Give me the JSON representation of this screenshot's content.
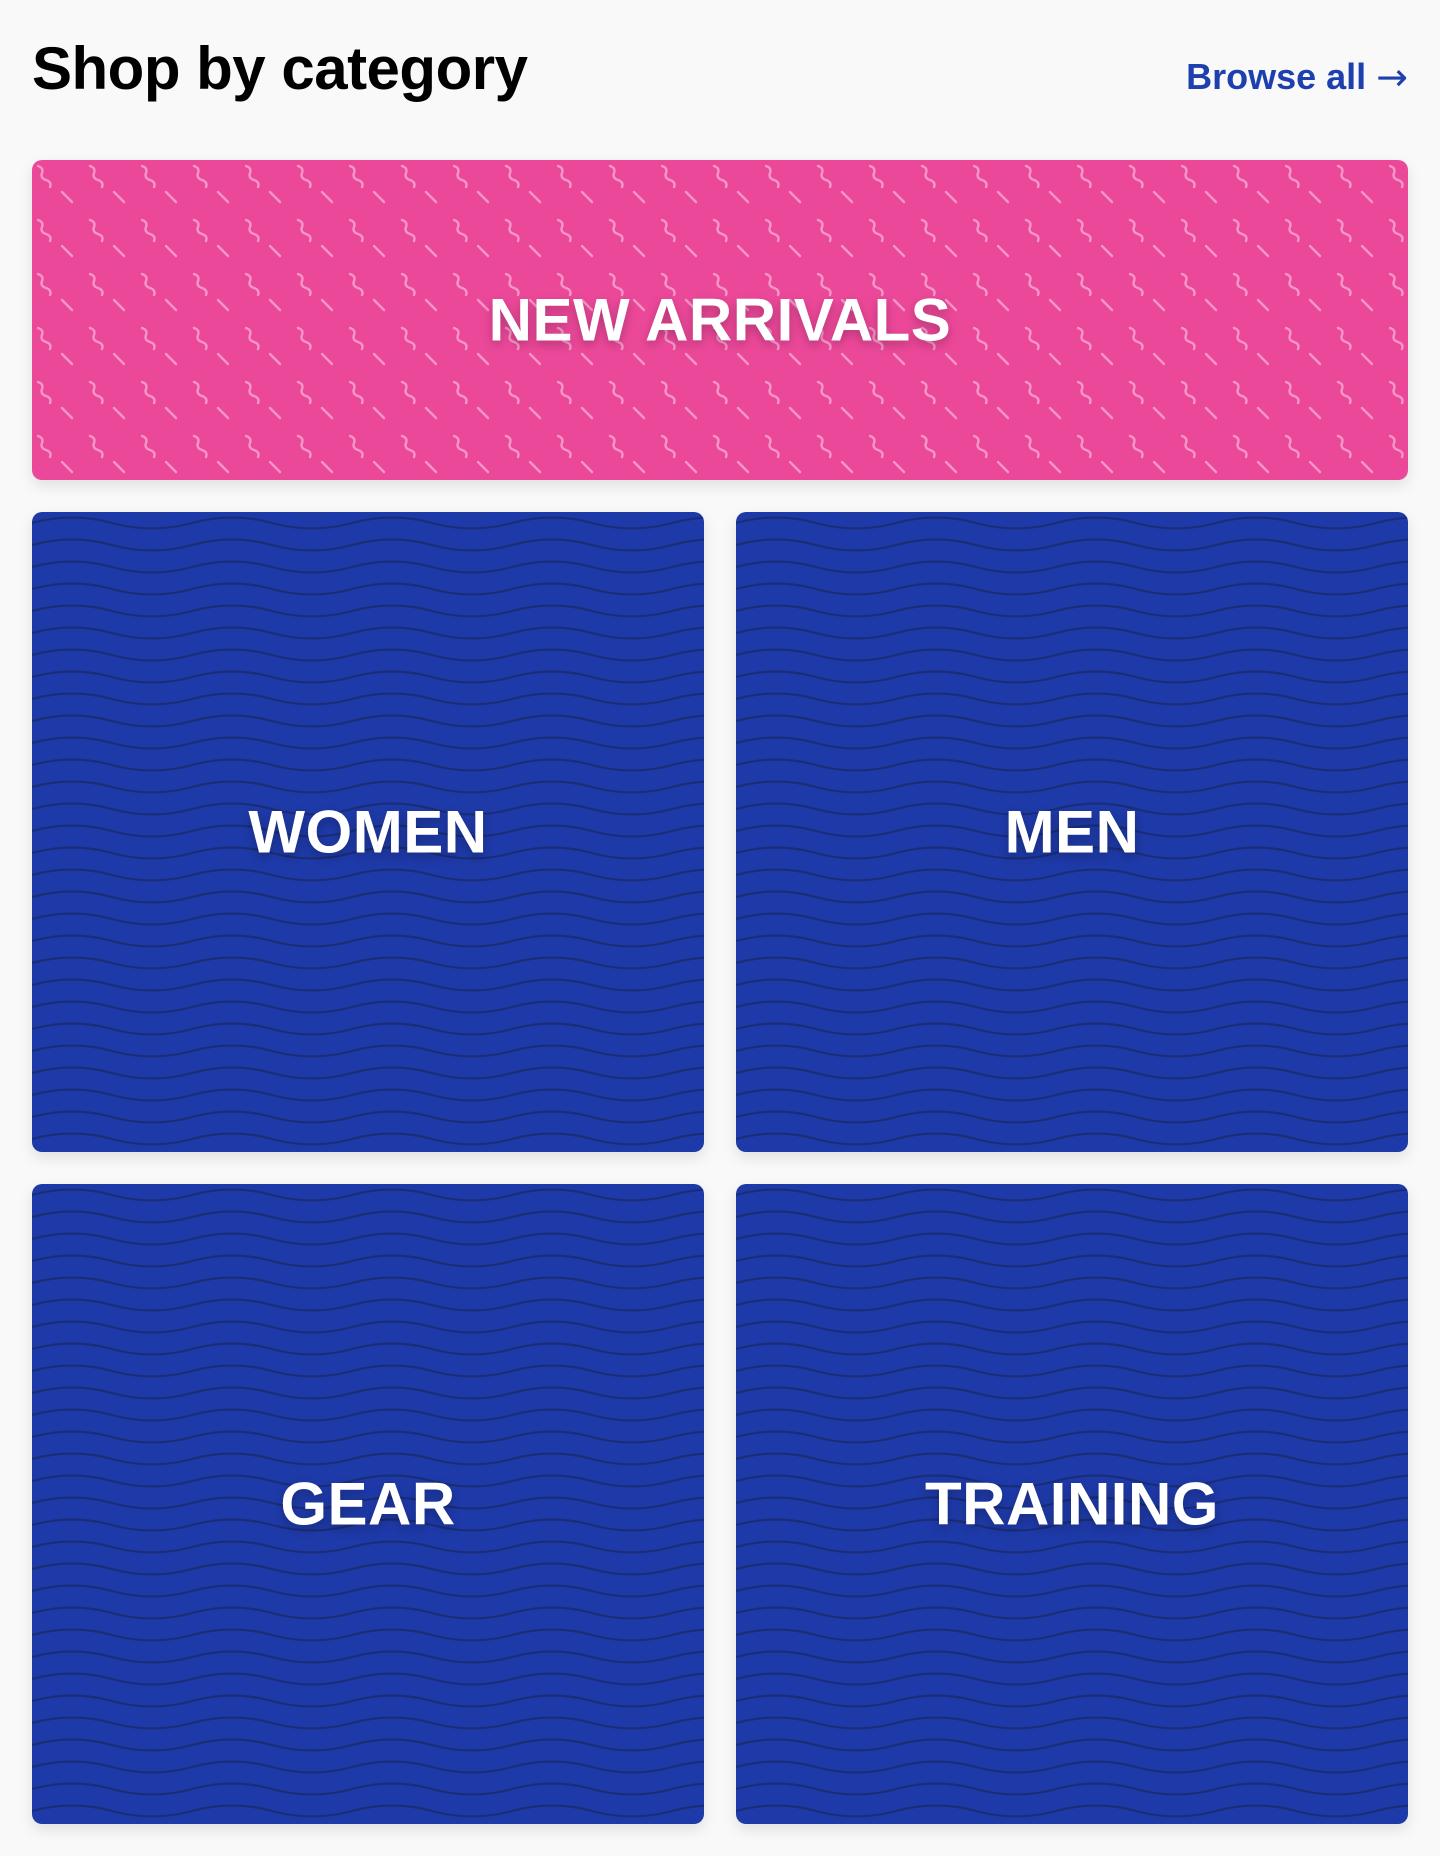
{
  "header": {
    "title": "Shop by category",
    "browse_all_label": "Browse all",
    "browse_all_arrow": "→"
  },
  "categories": [
    {
      "label": "NEW ARRIVALS",
      "color": "#ec4899",
      "pattern": "squiggle"
    },
    {
      "label": "WOMEN",
      "color": "#1e3aa8",
      "pattern": "waves"
    },
    {
      "label": "MEN",
      "color": "#1e3aa8",
      "pattern": "waves"
    },
    {
      "label": "GEAR",
      "color": "#1e3aa8",
      "pattern": "waves"
    },
    {
      "label": "TRAINING",
      "color": "#1e3aa8",
      "pattern": "waves"
    }
  ],
  "colors": {
    "background": "#f9f9f9",
    "link": "#1e40af",
    "pink": "#ec4899",
    "blue": "#1e3aa8"
  }
}
